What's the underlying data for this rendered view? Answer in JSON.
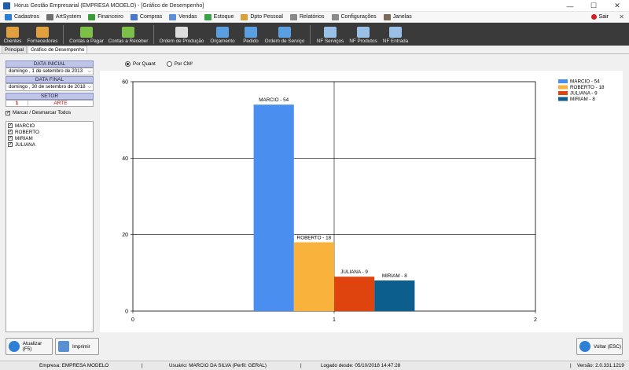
{
  "window": {
    "title": "Hórus Gestão Empresarial (EMPRESA MODELO) - [Gráfico de Desempenho]",
    "minimize": "—",
    "maximize": "☐",
    "close": "✕"
  },
  "menu": {
    "items": [
      {
        "label": "Cadastros",
        "icon": "cadastros-icon",
        "color": "#2a7fd4"
      },
      {
        "label": "ArtSystem",
        "icon": "artsystem-icon",
        "color": "#6d6d6d"
      },
      {
        "label": "Financeiro",
        "icon": "financeiro-icon",
        "color": "#3b9b3b"
      },
      {
        "label": "Compras",
        "icon": "compras-icon",
        "color": "#4a78c8"
      },
      {
        "label": "Vendas",
        "icon": "vendas-icon",
        "color": "#5c8fd6"
      },
      {
        "label": "Estoque",
        "icon": "estoque-icon",
        "color": "#3aa04a"
      },
      {
        "label": "Dpto Pessoal",
        "icon": "dpto-pessoal-icon",
        "color": "#d7a13a"
      },
      {
        "label": "Relatórios",
        "icon": "relatorios-icon",
        "color": "#888888"
      },
      {
        "label": "Configurações",
        "icon": "configuracoes-icon",
        "color": "#8a8a8a"
      },
      {
        "label": "Janelas",
        "icon": "janelas-icon",
        "color": "#7a6a5a"
      }
    ],
    "exit_label": "Sair",
    "close_glyph": "✕"
  },
  "toolbar": {
    "items": [
      {
        "label": "Clientes",
        "icon": "clientes-icon",
        "color": "#e0a040",
        "width": 32
      },
      {
        "label": "Fornecedores",
        "icon": "fornecedores-icon",
        "color": "#e0a040",
        "width": 44
      },
      {
        "label": "Contas a Pagar",
        "icon": "contas-pagar-icon",
        "color": "#7cc04a",
        "width": 50,
        "sep": true
      },
      {
        "label": "Contas a Receber",
        "icon": "contas-receber-icon",
        "color": "#7cc04a",
        "width": 56
      },
      {
        "label": "Ordem de Produção",
        "icon": "ordem-producao-icon",
        "color": "#dcdcdc",
        "width": 62,
        "sep": true
      },
      {
        "label": "Orçamento",
        "icon": "orcamento-icon",
        "color": "#5aa0e0",
        "width": 42
      },
      {
        "label": "Pedido",
        "icon": "pedido-icon",
        "color": "#5aa0e0",
        "width": 30
      },
      {
        "label": "Ordem de Serviço",
        "icon": "ordem-servico-icon",
        "color": "#5aa0e0",
        "width": 56
      },
      {
        "label": "NF Serviços",
        "icon": "nf-servicos-icon",
        "color": "#9ac0e8",
        "width": 42,
        "sep": true
      },
      {
        "label": "NF Produtos",
        "icon": "nf-produtos-icon",
        "color": "#9ac0e8",
        "width": 42
      },
      {
        "label": "NF Entrada",
        "icon": "nf-entrada-icon",
        "color": "#9ac0e8",
        "width": 40
      }
    ]
  },
  "tabs": [
    {
      "label": "Principal",
      "active": false
    },
    {
      "label": "Gráfico de Desempenho",
      "active": true
    }
  ],
  "filters": {
    "data_inicial_label": "DATA INICIAL",
    "data_inicial_value": "domingo  ,  1 de setembro de 2013",
    "data_final_label": "DATA FINAL",
    "data_final_value": "domingo  , 30 de setembro de 2018",
    "dropdown_glyph": "⌵",
    "setor_label": "SETOR",
    "setor_code": "1",
    "setor_name": "ARTE",
    "toggle_all_label": "Marcar / Desmarcar Todos",
    "check_glyph": "✓",
    "employees": [
      "MARCIO",
      "ROBERTO",
      "MIRIAM",
      "JULIANA"
    ]
  },
  "options": {
    "por_quant": "Por Quant",
    "por_cm2": "Por CM²",
    "selected": "por_quant"
  },
  "chart_data": {
    "type": "bar",
    "title": "",
    "xlabel": "",
    "ylabel": "",
    "xlim": [
      0,
      2
    ],
    "ylim": [
      0,
      60
    ],
    "x_ticks": [
      0,
      1,
      2
    ],
    "y_ticks": [
      0,
      20,
      40,
      60
    ],
    "grid": true,
    "legend_position": "top-right",
    "series": [
      {
        "name": "MARCIO - 54",
        "label": "MARCIO - 54",
        "value": 54,
        "color": "#4a8ff0"
      },
      {
        "name": "ROBERTO - 18",
        "label": "ROBERTO - 18",
        "value": 18,
        "color": "#f9b23c"
      },
      {
        "name": "JULIANA - 9",
        "label": "JULIANA - 9",
        "value": 9,
        "color": "#e0440e"
      },
      {
        "name": "MIRIAM - 8",
        "label": "MIRIAM - 8",
        "value": 8,
        "color": "#0c5f8c"
      }
    ]
  },
  "buttons": {
    "atualizar": "Atualizar (F5)",
    "imprimir": "Imprimir",
    "voltar": "Voltar (ESC)"
  },
  "status": {
    "empresa": "Empresa: EMPRESA MODELO",
    "usuario": "Usuário: MARCIO DA SILVA (Perfil: GERAL)",
    "logado": "Logado desde: 05/10/2018 14:47:28",
    "versao": "Versão: 2.0.331.1219",
    "separator": "|"
  }
}
